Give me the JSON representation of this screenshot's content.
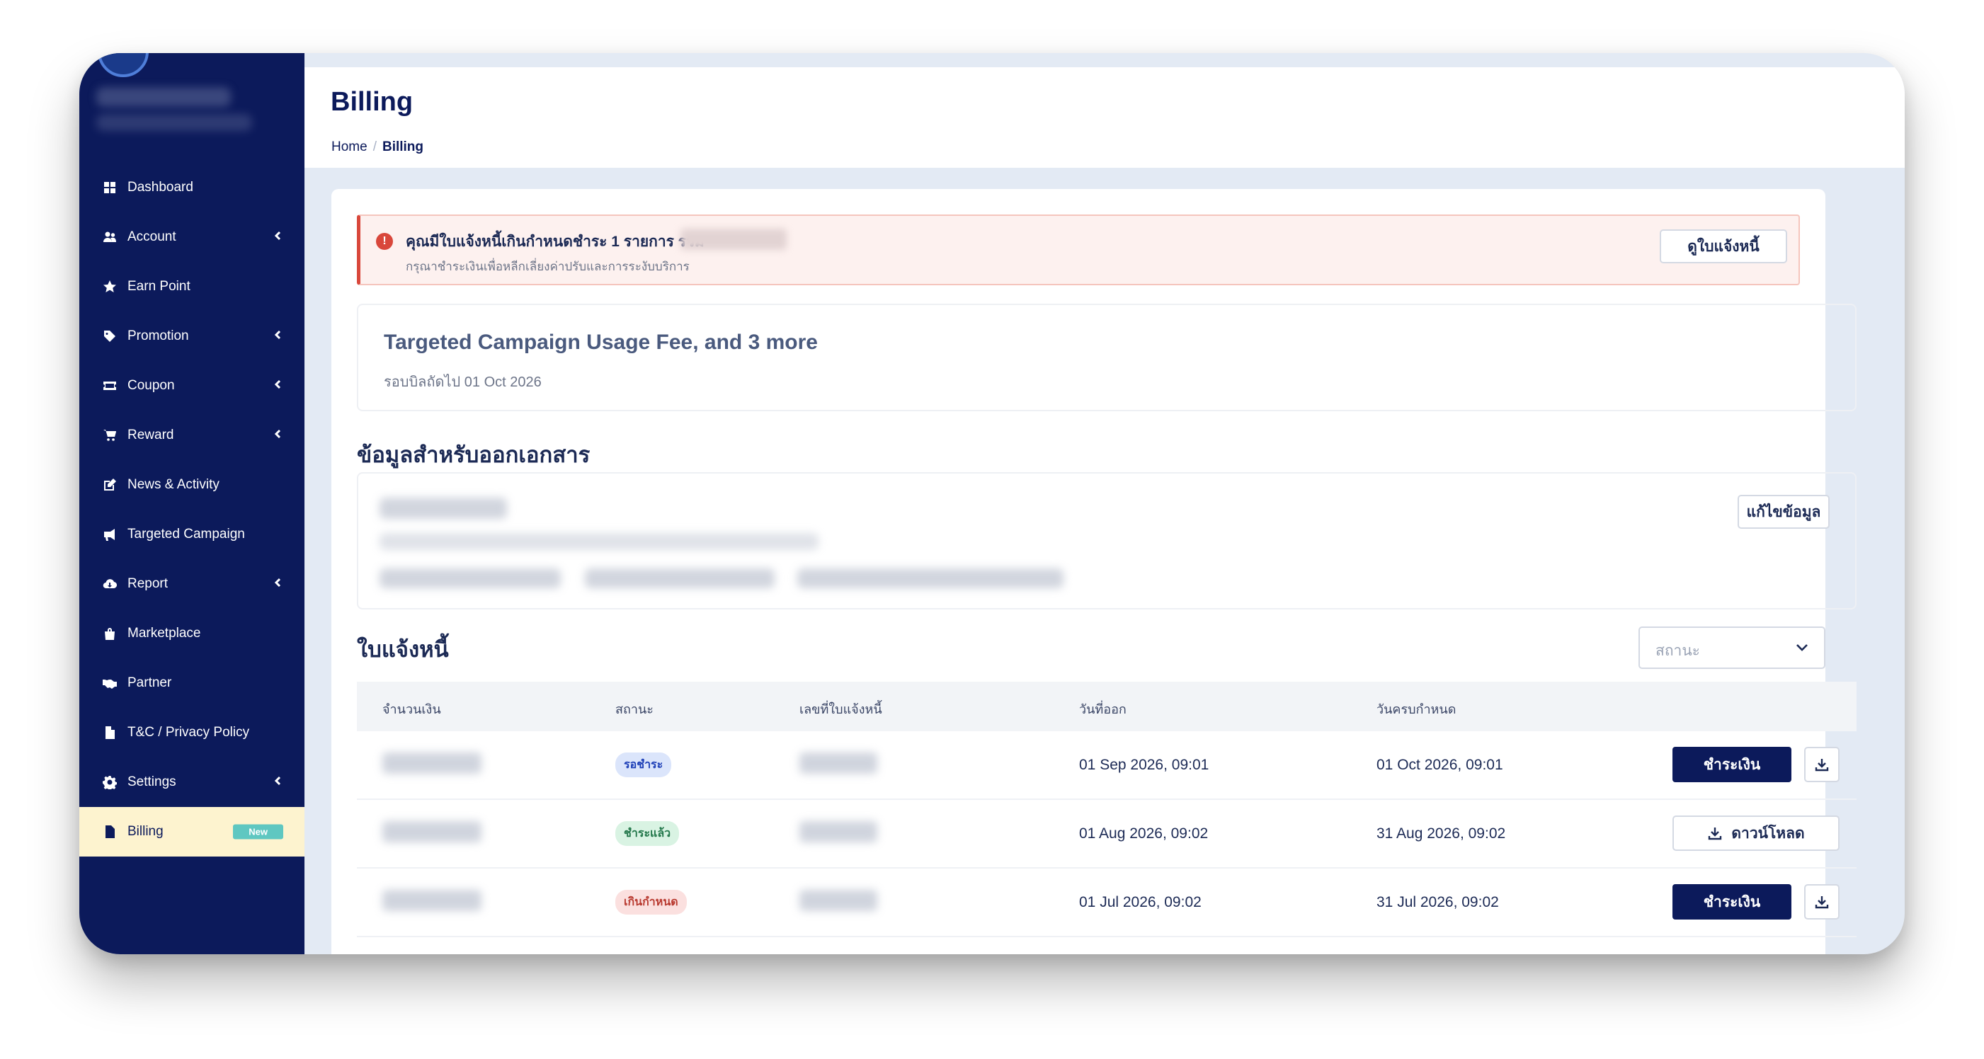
{
  "sidebar": {
    "items": [
      {
        "label": "Dashboard",
        "icon": "dashboard-icon",
        "has_submenu": false
      },
      {
        "label": "Account",
        "icon": "users-icon",
        "has_submenu": true
      },
      {
        "label": "Earn Point",
        "icon": "star-icon",
        "has_submenu": false
      },
      {
        "label": "Promotion",
        "icon": "tag-icon",
        "has_submenu": true
      },
      {
        "label": "Coupon",
        "icon": "ticket-icon",
        "has_submenu": true
      },
      {
        "label": "Reward",
        "icon": "cart-icon",
        "has_submenu": true
      },
      {
        "label": "News & Activity",
        "icon": "edit-icon",
        "has_submenu": false
      },
      {
        "label": "Targeted Campaign",
        "icon": "megaphone-icon",
        "has_submenu": false
      },
      {
        "label": "Report",
        "icon": "cloud-download-icon",
        "has_submenu": true
      },
      {
        "label": "Marketplace",
        "icon": "bag-icon",
        "has_submenu": false
      },
      {
        "label": "Partner",
        "icon": "handshake-icon",
        "has_submenu": false
      },
      {
        "label": "T&C / Privacy Policy",
        "icon": "file-icon",
        "has_submenu": false
      },
      {
        "label": "Settings",
        "icon": "gear-icon",
        "has_submenu": true
      },
      {
        "label": "Billing",
        "icon": "file-invoice-icon",
        "has_submenu": false,
        "active": true,
        "badge": "New"
      }
    ]
  },
  "header": {
    "title": "Billing",
    "breadcrumb": {
      "home": "Home",
      "separator": "/",
      "current": "Billing"
    }
  },
  "alert": {
    "title": "คุณมีใบแจ้งหนี้เกินกำหนดชำระ 1 รายการ รวม",
    "subtitle": "กรุณาชำระเงินเพื่อหลีกเลี่ยงค่าปรับและการระงับบริการ",
    "button": "ดูใบแจ้งหนี้",
    "color": "#d9473b"
  },
  "summary": {
    "title": "Targeted Campaign Usage Fee, and 3 more",
    "next_billing": "รอบบิลถัดไป 01 Oct 2026"
  },
  "document_info": {
    "title": "ข้อมูลสำหรับออกเอกสาร",
    "edit_button": "แก้ไขข้อมูล"
  },
  "invoices": {
    "title": "ใบแจ้งหนี้",
    "status_filter_placeholder": "สถานะ",
    "columns": [
      "จำนวนเงิน",
      "สถานะ",
      "เลขที่ใบแจ้งหนี้",
      "วันที่ออก",
      "วันครบกำหนด"
    ],
    "rows": [
      {
        "status": "รอชำระ",
        "status_kind": "pending",
        "issued": "01 Sep 2026, 09:01",
        "due": "01 Oct 2026, 09:01",
        "action": "ชำระเงิน"
      },
      {
        "status": "ชำระแล้ว",
        "status_kind": "paid",
        "issued": "01 Aug 2026, 09:02",
        "due": "31 Aug 2026, 09:02",
        "action": "ดาวน์โหลด"
      },
      {
        "status": "เกินกำหนด",
        "status_kind": "overdue",
        "issued": "01 Jul 2026, 09:02",
        "due": "31 Jul 2026, 09:02",
        "action": "ชำระเงิน"
      }
    ]
  },
  "colors": {
    "sidebar_bg": "#0c1a5b",
    "active_bg": "#fdf3cf",
    "primary_button": "#0c1a5b",
    "badge_new": "#5fc7c1"
  }
}
